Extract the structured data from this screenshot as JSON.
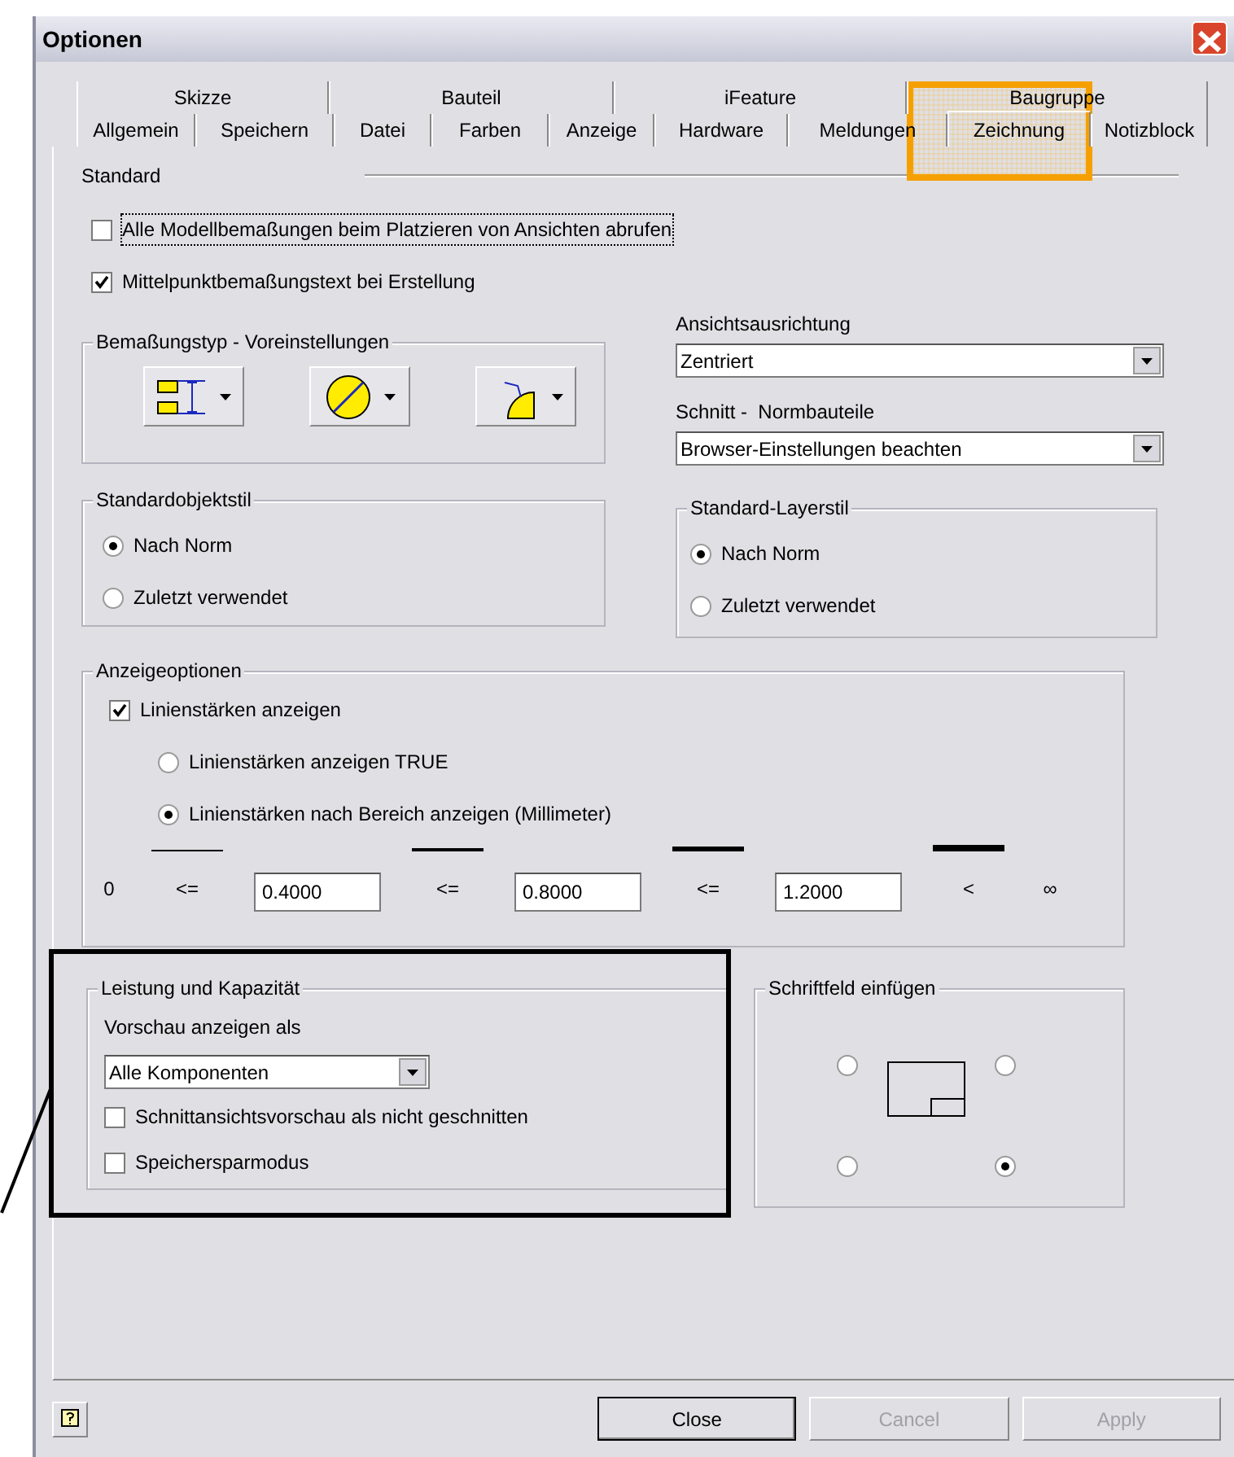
{
  "window": {
    "title": "Optionen"
  },
  "tabs_row_1": [
    {
      "label": "Skizze",
      "selected": false
    },
    {
      "label": "Bauteil",
      "selected": false
    },
    {
      "label": "iFeature",
      "selected": false
    },
    {
      "label": "Baugruppe",
      "selected": false
    }
  ],
  "tabs_row_2": [
    {
      "label": "Allgemein",
      "selected": false
    },
    {
      "label": "Speichern",
      "selected": false
    },
    {
      "label": "Datei",
      "selected": false
    },
    {
      "label": "Farben",
      "selected": false
    },
    {
      "label": "Anzeige",
      "selected": false
    },
    {
      "label": "Hardware",
      "selected": false
    },
    {
      "label": "Meldungen",
      "selected": false
    },
    {
      "label": "Zeichnung",
      "selected": true
    },
    {
      "label": "Notizblock",
      "selected": false
    }
  ],
  "standard": {
    "heading": "Standard",
    "checkboxes": [
      {
        "label": "Alle Modellbemaßungen beim Platzieren von Ansichten abrufen",
        "checked": false,
        "focused": true
      },
      {
        "label": "Mittelpunktbemaßungstext bei Erstellung",
        "checked": true,
        "focused": false
      }
    ]
  },
  "bemassungstyp": {
    "title": "Bemaßungstyp - Voreinstellungen",
    "buttons": [
      {
        "kind": "linear"
      },
      {
        "kind": "diameter"
      },
      {
        "kind": "radius"
      }
    ]
  },
  "standardobjektstil": {
    "title": "Standardobjektstil",
    "options": [
      {
        "label": "Nach Norm",
        "selected": true
      },
      {
        "label": "Zuletzt verwendet",
        "selected": false
      }
    ]
  },
  "ansichtsausrichtung": {
    "label": "Ansichtsausrichtung",
    "value": "Zentriert"
  },
  "schnitt": {
    "label": "Schnitt -  Normbauteile",
    "value": "Browser-Einstellungen beachten"
  },
  "layerstil": {
    "title": "Standard-Layerstil",
    "options": [
      {
        "label": "Nach Norm",
        "selected": true
      },
      {
        "label": "Zuletzt verwendet",
        "selected": false
      }
    ]
  },
  "anzeigeoptionen": {
    "title": "Anzeigeoptionen",
    "checkbox": {
      "label": "Linienstärken anzeigen",
      "checked": true
    },
    "options": [
      {
        "label": "Linienstärken anzeigen TRUE",
        "selected": false
      },
      {
        "label": "Linienstärken nach Bereich anzeigen (Millimeter)",
        "selected": true
      }
    ],
    "scale": [
      {
        "kind": "text",
        "text": "0"
      },
      {
        "kind": "operator",
        "text": "<="
      },
      {
        "kind": "field",
        "value": "0.4000"
      },
      {
        "kind": "operator",
        "text": "<="
      },
      {
        "kind": "field",
        "value": "0.8000"
      },
      {
        "kind": "operator",
        "text": "<="
      },
      {
        "kind": "field",
        "value": "1.2000"
      },
      {
        "kind": "operator",
        "text": "<"
      },
      {
        "kind": "text",
        "text": "∞"
      }
    ]
  },
  "leistung": {
    "title": "Leistung und Kapazität",
    "label": "Vorschau anzeigen als",
    "value": "Alle Komponenten",
    "checkboxes": [
      {
        "label": "Schnittansichtsvorschau als nicht geschnitten",
        "checked": false
      },
      {
        "label": "Speichersparmodus",
        "checked": false
      }
    ]
  },
  "schriftfeld": {
    "title": "Schriftfeld einfügen",
    "corners": [
      {
        "selected": false
      },
      {
        "selected": false
      },
      {
        "selected": false
      },
      {
        "selected": true
      }
    ]
  },
  "buttons": [
    {
      "kind": "help"
    },
    {
      "kind": "text",
      "label": "Close",
      "disabled": false
    },
    {
      "kind": "text",
      "label": "Cancel",
      "disabled": true
    },
    {
      "kind": "text",
      "label": "Apply",
      "disabled": true
    }
  ],
  "annotations": {
    "tab_highlight": true,
    "group_frame": true
  }
}
